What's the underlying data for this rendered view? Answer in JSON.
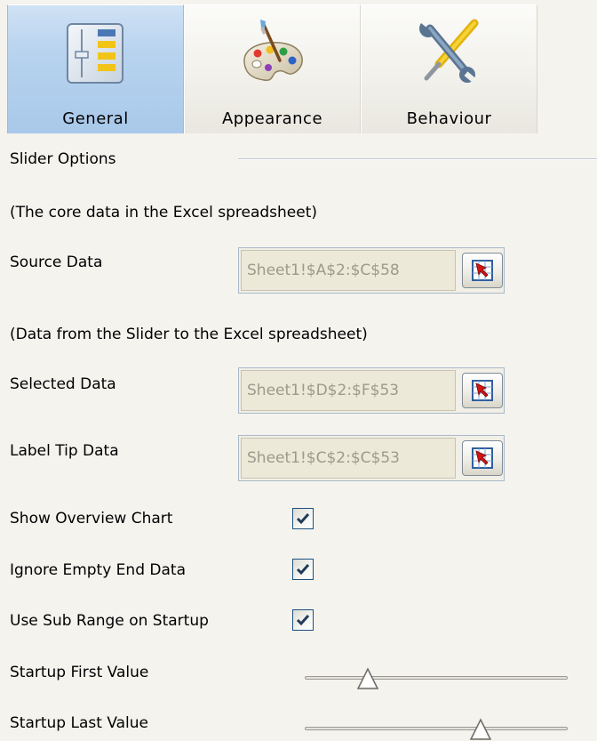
{
  "tabs": [
    {
      "label": "General",
      "icon": "general-settings-icon",
      "active": true
    },
    {
      "label": "Appearance",
      "icon": "paint-palette-icon",
      "active": false
    },
    {
      "label": "Behaviour",
      "icon": "tools-icon",
      "active": false
    }
  ],
  "slider_options": {
    "title": "Slider Options",
    "core_data_note": "(The core data in the Excel spreadsheet)",
    "source_data": {
      "label": "Source Data",
      "value": "Sheet1!$A$2:$C$58"
    },
    "slider_data_note": "(Data from the Slider to the Excel spreadsheet)",
    "selected_data": {
      "label": "Selected Data",
      "value": "Sheet1!$D$2:$F$53"
    },
    "label_tip_data": {
      "label": "Label Tip Data",
      "value": "Sheet1!$C$2:$C$53"
    },
    "show_overview_chart": {
      "label": "Show Overview Chart",
      "checked": true
    },
    "ignore_empty_end_data": {
      "label": "Ignore Empty End Data",
      "checked": true
    },
    "use_sub_range_on_startup": {
      "label": "Use Sub Range on Startup",
      "checked": true
    },
    "startup_first_value": {
      "label": "Startup First Value",
      "position": 0.24
    },
    "startup_last_value": {
      "label": "Startup Last Value",
      "position": 0.67
    }
  },
  "colors": {
    "active_tab": "#b6d2ee",
    "background": "#f4f3ee",
    "checkmark": "#213b5a",
    "disabled_text": "#9d9a8c"
  }
}
